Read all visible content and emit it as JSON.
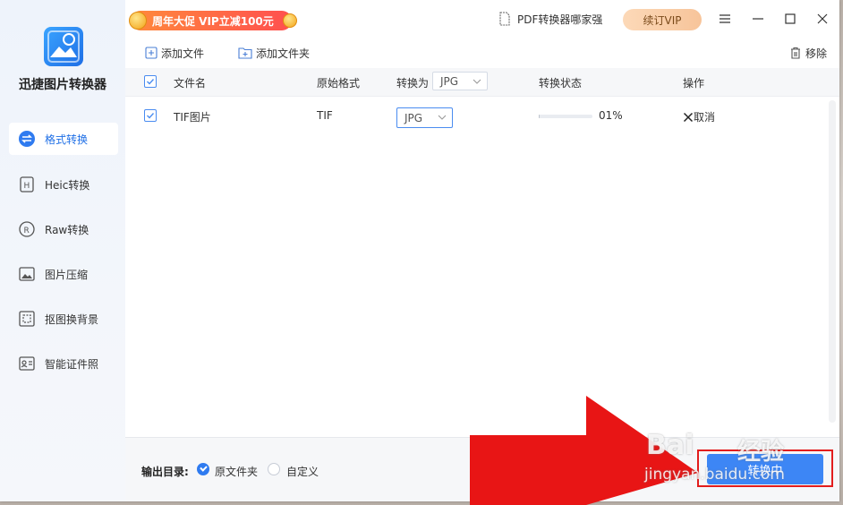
{
  "app": {
    "name": "迅捷图片转换器"
  },
  "sidebar": {
    "items": [
      {
        "label": "格式转换",
        "icon": "format-convert-icon",
        "active": true
      },
      {
        "label": "Heic转换",
        "icon": "heic-icon",
        "active": false
      },
      {
        "label": "Raw转换",
        "icon": "raw-icon",
        "active": false
      },
      {
        "label": "图片压缩",
        "icon": "image-compress-icon",
        "active": false
      },
      {
        "label": "抠图换背景",
        "icon": "cutout-icon",
        "active": false
      },
      {
        "label": "智能证件照",
        "icon": "id-photo-icon",
        "active": false
      }
    ]
  },
  "topbar": {
    "promo_text": "周年大促 VIP立减100元",
    "pdf_link": "PDF转换器哪家强",
    "vip_button": "续订VIP"
  },
  "toolbar": {
    "add_file": "添加文件",
    "add_folder": "添加文件夹",
    "remove": "移除"
  },
  "table": {
    "headers": {
      "filename": "文件名",
      "original_format": "原始格式",
      "convert_to": "转换为",
      "status": "转换状态",
      "action": "操作"
    },
    "header_format_select": "JPG",
    "rows": [
      {
        "filename": "TIF图片",
        "original_format": "TIF",
        "target_format": "JPG",
        "progress_percent": 1,
        "progress_text": "01%",
        "action": "取消"
      }
    ]
  },
  "bottom": {
    "output_label": "输出目录:",
    "option_original": "原文件夹",
    "option_custom": "自定义",
    "selected": "原文件夹",
    "convert_button": "转换中"
  },
  "watermark": {
    "brand": "Bai",
    "brand2": "经验",
    "url": "jingyan.baidu.com"
  },
  "colors": {
    "accent": "#3d86f5",
    "arrow": "#e81515",
    "highlight": "#e21d1d"
  }
}
